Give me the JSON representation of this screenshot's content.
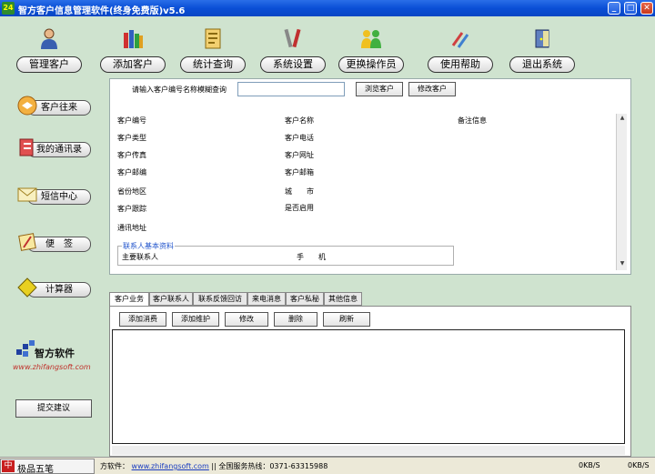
{
  "window": {
    "icon_text": "24",
    "title": "智方客户信息管理软件(终身免费版)v5.6",
    "minimize": "_",
    "maximize": "□",
    "close": "✕"
  },
  "toolbar": {
    "items": [
      {
        "label": "管理客户",
        "icon": "person-icon"
      },
      {
        "label": "添加客户",
        "icon": "books-icon"
      },
      {
        "label": "统计查询",
        "icon": "document-icon"
      },
      {
        "label": "系统设置",
        "icon": "tools-icon"
      },
      {
        "label": "更换操作员",
        "icon": "people-icon"
      },
      {
        "label": "使用帮助",
        "icon": "help-icon"
      },
      {
        "label": "退出系统",
        "icon": "exit-icon"
      }
    ]
  },
  "sidebar": {
    "items": [
      {
        "label": "客户往来"
      },
      {
        "label": "我的通讯录"
      },
      {
        "label": "短信中心"
      },
      {
        "label": "便　签"
      },
      {
        "label": "计算器"
      }
    ],
    "logo_name": "智方软件",
    "logo_url": "www.zhifangsoft.com",
    "suggest_button": "提交建议"
  },
  "main": {
    "search_label": "请输入客户编号名称模糊查询",
    "search_value": "",
    "browse_button": "浏览客户",
    "edit_button": "修改客户",
    "fields": {
      "customer_id": "客户编号",
      "customer_type": "客户类型",
      "customer_fax": "客户传真",
      "customer_zip": "客户邮编",
      "province": "省份地区",
      "customer_track": "客户跟踪",
      "address": "通讯地址",
      "customer_name": "客户名称",
      "customer_phone": "客户电话",
      "customer_website": "客户网址",
      "customer_email": "客户邮箱",
      "city": "城　　市",
      "enabled": "是否启用",
      "remarks": "备注信息"
    },
    "contact_legend": "联系人基本资料",
    "main_contact": "主要联系人",
    "mobile": "手　　机"
  },
  "tabs": {
    "items": [
      {
        "label": "客户业务"
      },
      {
        "label": "客户联系人"
      },
      {
        "label": "联系反馈回访"
      },
      {
        "label": "来电消息"
      },
      {
        "label": "客户私秘"
      },
      {
        "label": "其他信息"
      }
    ],
    "active_index": 0,
    "buttons": {
      "add_consume": "添加消费",
      "add_maintain": "添加维护",
      "edit": "修改",
      "delete": "删除",
      "refresh": "刷新"
    }
  },
  "statusbar": {
    "ime_zh": "中",
    "ime_name": "极品五笔",
    "software_label": "方软件：",
    "software_link": "www.zhifangsoft.com",
    "hotline": "|| 全国服务热线：0371-63315988",
    "net_down": "0KB/S",
    "net_up": "0KB/S"
  },
  "colors": {
    "background": "#cfe3cf",
    "titlebar": "#0a4fd6",
    "link": "#1a3dc0",
    "legend": "#2255cc"
  }
}
